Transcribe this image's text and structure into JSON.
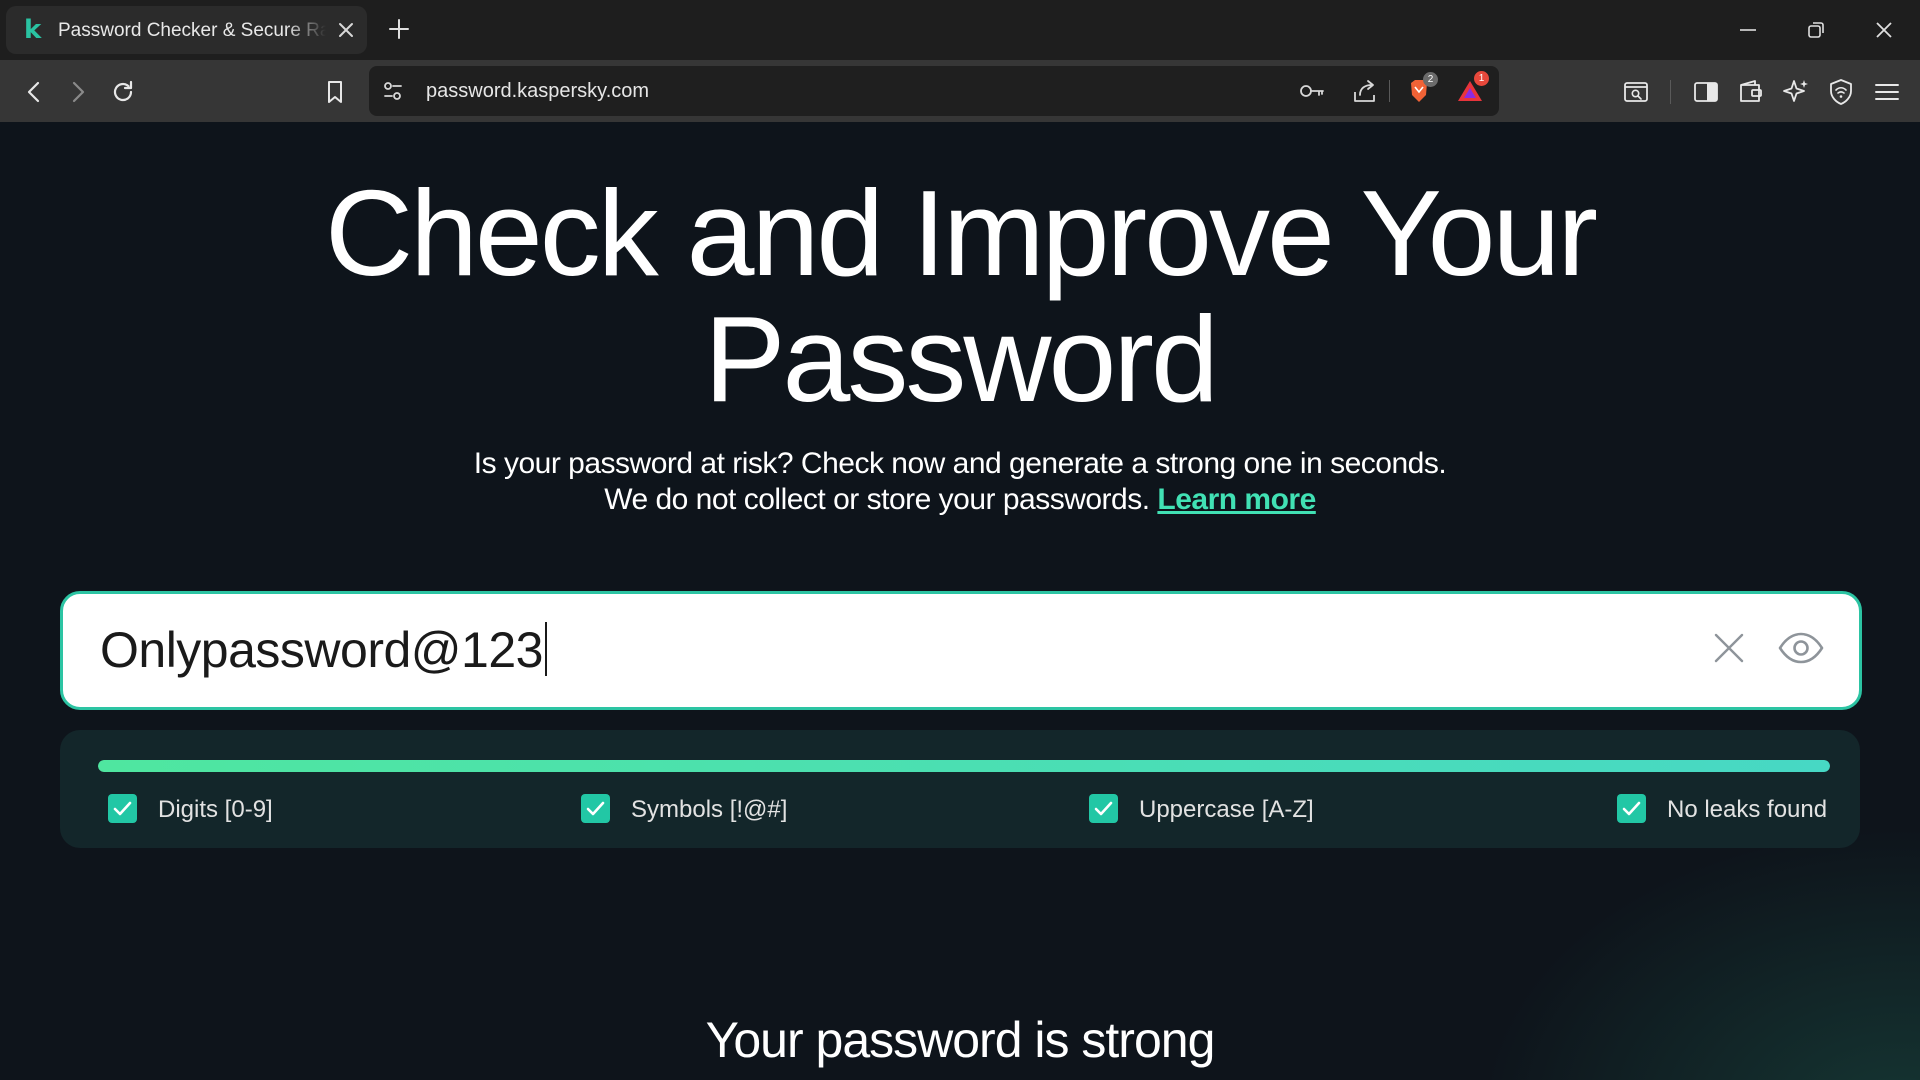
{
  "browser": {
    "tab": {
      "title": "Password Checker & Secure Random Password Generator",
      "favicon_letter": "k"
    },
    "address": {
      "url": "password.kaspersky.com"
    },
    "badges": {
      "brave_shields_count": "2",
      "rewards_count": "1"
    }
  },
  "page": {
    "title_line1": "Check and Improve Your",
    "title_line2": "Password",
    "subtitle_line1": "Is your password at risk? Check now and generate a strong one in seconds.",
    "subtitle_line2": "We do not collect or store your passwords.",
    "learn_more": "Learn more",
    "password": {
      "value": "Onlypassword@123"
    },
    "strength": {
      "level": 1.0
    },
    "checks": [
      {
        "label": "Digits [0-9]",
        "checked": true
      },
      {
        "label": "Symbols [!@#]",
        "checked": true
      },
      {
        "label": "Uppercase [A-Z]",
        "checked": true
      },
      {
        "label": "No leaks found",
        "checked": true
      }
    ],
    "verdict": "Your password is strong"
  },
  "colors": {
    "accent": "#2cc4a3",
    "link": "#41e1b4",
    "page_bg": "#0e141b",
    "panel_bg": "#13262a"
  }
}
